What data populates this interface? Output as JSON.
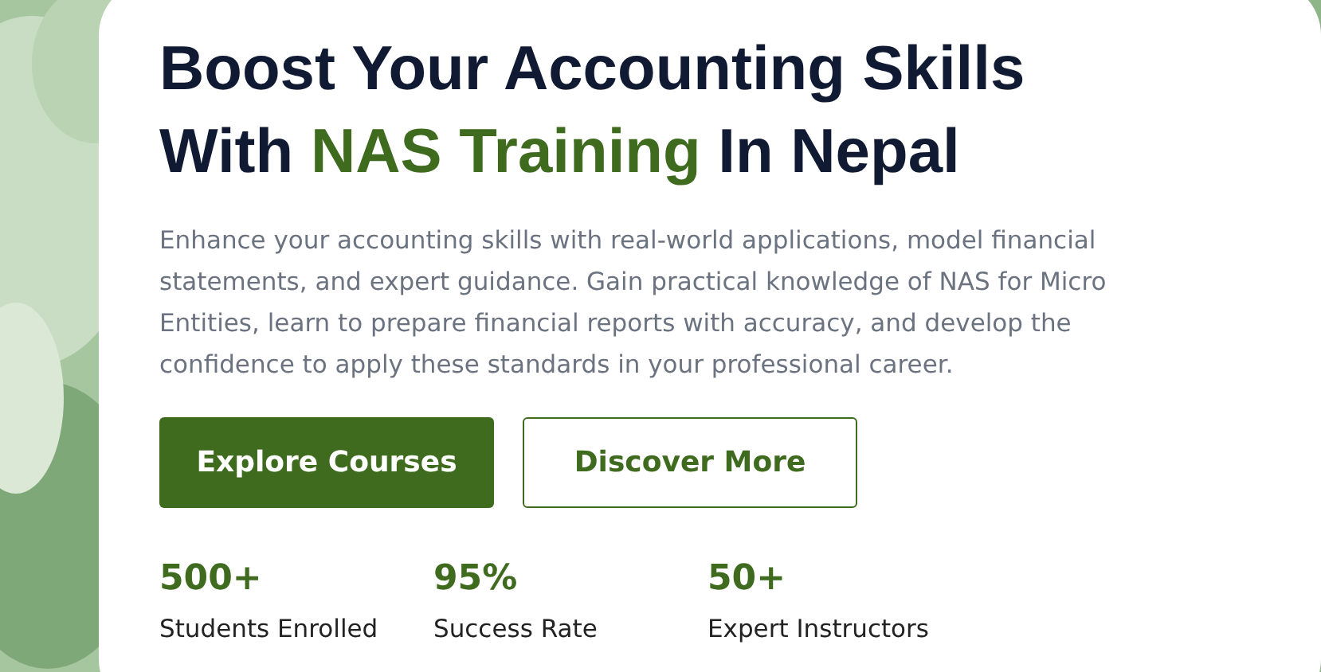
{
  "background": {
    "kind": "picture"
  },
  "heading": [
    [
      {
        "text": "Boost Your Accounting Skills",
        "highlight": false
      }
    ],
    [
      {
        "text": "With ",
        "highlight": false
      },
      {
        "text": "NAS Training",
        "highlight": true
      },
      {
        "text": " In Nepal",
        "highlight": false
      }
    ]
  ],
  "description": "Enhance your accounting skills with real-world applications, model financial statements, and expert guidance. Gain practical knowledge of NAS for Micro Entities, learn to prepare financial reports with accuracy, and develop the confidence to apply these standards in your professional career.",
  "buttons": [
    {
      "label": "Explore Courses",
      "kind": "primary"
    },
    {
      "label": "Discover More",
      "kind": "outline"
    }
  ],
  "stats": [
    {
      "value": "500+",
      "label": "Students Enrolled"
    },
    {
      "value": "95%",
      "label": "Success Rate"
    },
    {
      "value": "50+",
      "label": "Expert Instructors"
    }
  ]
}
